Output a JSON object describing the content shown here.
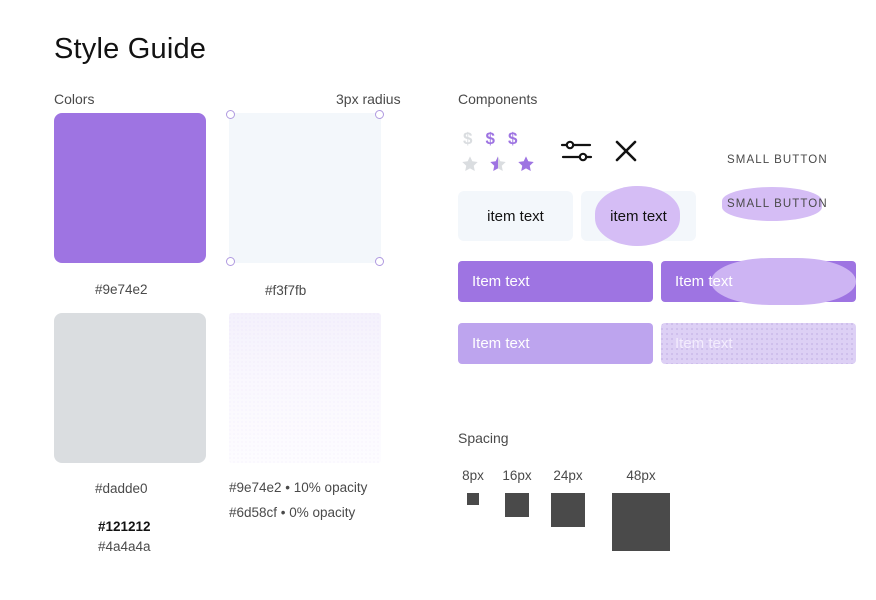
{
  "page": {
    "title": "Style Guide"
  },
  "colors_section": {
    "label": "Colors",
    "radius_label": "3px radius",
    "swatches": [
      {
        "name": "primary-purple",
        "caption": "#9e74e2",
        "hex": "#9e74e2"
      },
      {
        "name": "light-blue-gray",
        "caption": "#f3f7fb",
        "hex": "#f3f7fb"
      },
      {
        "name": "neutral-gray",
        "caption": "#dadde0",
        "hex": "#dadde0"
      },
      {
        "name": "purple-tint",
        "caption_line1": "#9e74e2 • 10% opacity",
        "caption_line2": "#6d58cf • 0% opacity"
      }
    ],
    "text_colors": {
      "primary": "#121212",
      "secondary": "#4a4a4a"
    }
  },
  "components_section": {
    "label": "Components",
    "money_icons": [
      {
        "name": "dollar-icon-inactive",
        "glyph": "$",
        "state": "inactive"
      },
      {
        "name": "dollar-icon-active",
        "glyph": "$",
        "state": "active"
      },
      {
        "name": "dollar-icon-active",
        "glyph": "$",
        "state": "active"
      }
    ],
    "star_icons": [
      {
        "name": "star-icon-empty",
        "state": "empty"
      },
      {
        "name": "star-icon-half",
        "state": "half"
      },
      {
        "name": "star-icon-full",
        "state": "full"
      }
    ],
    "sliders_icon": "sliders-icon",
    "close_icon": "close-icon",
    "small_button_plain": "SMALL BUTTON",
    "small_button_highlighted": "SMALL BUTTON",
    "chips": [
      {
        "label": "item text",
        "state": "default"
      },
      {
        "label": "item text",
        "state": "highlighted"
      }
    ],
    "bars": [
      {
        "label": "Item text",
        "state": "default",
        "bg": "#9e74e2"
      },
      {
        "label": "Item text",
        "state": "highlighted",
        "bg": "#9e74e2"
      },
      {
        "label": "Item text",
        "state": "light",
        "bg": "#bda4ee"
      },
      {
        "label": "Item text",
        "state": "disabled",
        "bg": "#ddd0f5"
      }
    ]
  },
  "spacing_section": {
    "label": "Spacing",
    "items": [
      {
        "label": "8px",
        "size": 8
      },
      {
        "label": "16px",
        "size": 16
      },
      {
        "label": "24px",
        "size": 24
      },
      {
        "label": "48px",
        "size": 48
      }
    ],
    "swatch_color": "#4a4a4a"
  }
}
